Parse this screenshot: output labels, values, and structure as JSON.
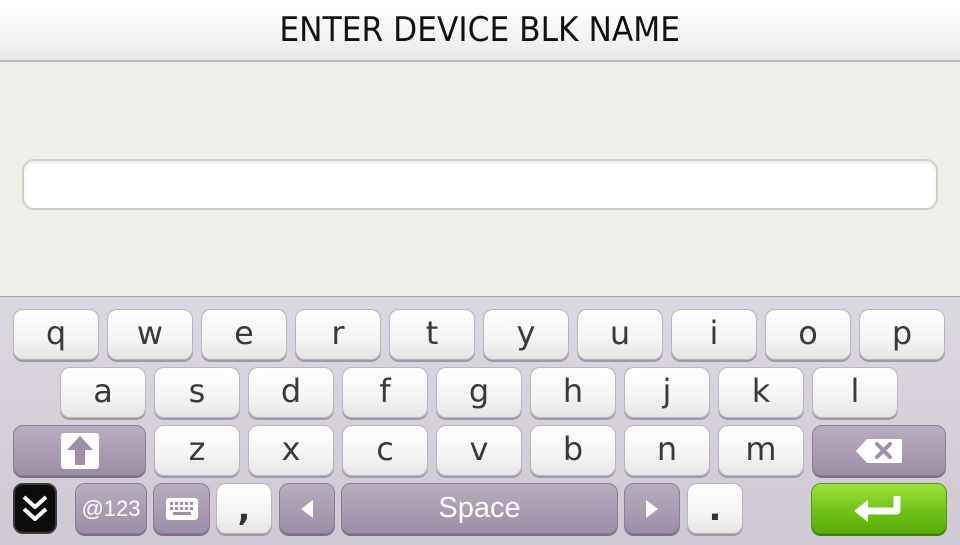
{
  "header": {
    "title": "ENTER DEVICE BLK NAME"
  },
  "input": {
    "value": "",
    "placeholder": ""
  },
  "keyboard": {
    "row1": [
      "q",
      "w",
      "e",
      "r",
      "t",
      "y",
      "u",
      "i",
      "o",
      "p"
    ],
    "row2": [
      "a",
      "s",
      "d",
      "f",
      "g",
      "h",
      "j",
      "k",
      "l"
    ],
    "row3": [
      "z",
      "x",
      "c",
      "v",
      "b",
      "n",
      "m"
    ],
    "shift_icon": "shift-arrow-up-icon",
    "backspace_icon": "backspace-x-icon",
    "hide_icon": "double-chevron-down-icon",
    "symbols_label": "@123",
    "keyboard_icon": "keyboard-icon",
    "comma_label": ",",
    "left_icon": "triangle-left-icon",
    "space_label": "Space",
    "right_icon": "triangle-right-icon",
    "period_label": ".",
    "enter_icon": "return-arrow-icon",
    "colors": {
      "func_key": "#9d8fa6",
      "enter_key": "#6cc113",
      "background": "#f0f0eb"
    }
  }
}
